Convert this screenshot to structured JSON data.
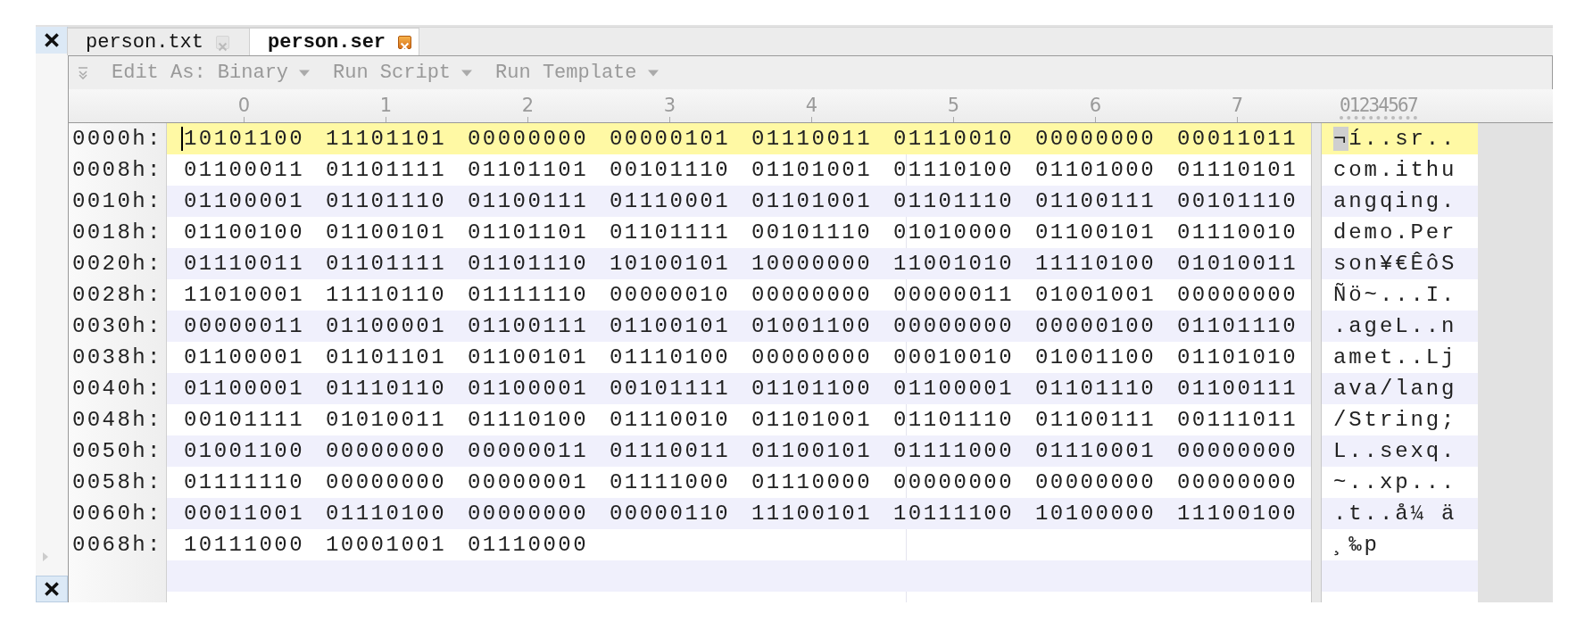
{
  "tabs": [
    {
      "label": "person.txt",
      "selected": false
    },
    {
      "label": "person.ser",
      "selected": true
    }
  ],
  "toolbar": {
    "items": [
      {
        "label": "Edit As: Binary"
      },
      {
        "label": "Run Script"
      },
      {
        "label": "Run Template"
      }
    ]
  },
  "ruler": {
    "columns": [
      "0",
      "1",
      "2",
      "3",
      "4",
      "5",
      "6",
      "7"
    ],
    "char_columns": "01234567"
  },
  "rows": [
    {
      "offset": "0000h:",
      "bytes": [
        "10101100",
        "11101101",
        "00000000",
        "00000101",
        "01110011",
        "01110010",
        "00000000",
        "00011011"
      ],
      "chars": "¬í..sr..",
      "selected": true
    },
    {
      "offset": "0008h:",
      "bytes": [
        "01100011",
        "01101111",
        "01101101",
        "00101110",
        "01101001",
        "01110100",
        "01101000",
        "01110101"
      ],
      "chars": "com.ithu",
      "selected": false
    },
    {
      "offset": "0010h:",
      "bytes": [
        "01100001",
        "01101110",
        "01100111",
        "01110001",
        "01101001",
        "01101110",
        "01100111",
        "00101110"
      ],
      "chars": "angqing.",
      "selected": false
    },
    {
      "offset": "0018h:",
      "bytes": [
        "01100100",
        "01100101",
        "01101101",
        "01101111",
        "00101110",
        "01010000",
        "01100101",
        "01110010"
      ],
      "chars": "demo.Per",
      "selected": false
    },
    {
      "offset": "0020h:",
      "bytes": [
        "01110011",
        "01101111",
        "01101110",
        "10100101",
        "10000000",
        "11001010",
        "11110100",
        "01010011"
      ],
      "chars": "son¥€ÊôS",
      "selected": false
    },
    {
      "offset": "0028h:",
      "bytes": [
        "11010001",
        "11110110",
        "01111110",
        "00000010",
        "00000000",
        "00000011",
        "01001001",
        "00000000"
      ],
      "chars": "Ñö~...I.",
      "selected": false
    },
    {
      "offset": "0030h:",
      "bytes": [
        "00000011",
        "01100001",
        "01100111",
        "01100101",
        "01001100",
        "00000000",
        "00000100",
        "01101110"
      ],
      "chars": ".ageL..n",
      "selected": false
    },
    {
      "offset": "0038h:",
      "bytes": [
        "01100001",
        "01101101",
        "01100101",
        "01110100",
        "00000000",
        "00010010",
        "01001100",
        "01101010"
      ],
      "chars": "amet..Lj",
      "selected": false
    },
    {
      "offset": "0040h:",
      "bytes": [
        "01100001",
        "01110110",
        "01100001",
        "00101111",
        "01101100",
        "01100001",
        "01101110",
        "01100111"
      ],
      "chars": "ava/lang",
      "selected": false
    },
    {
      "offset": "0048h:",
      "bytes": [
        "00101111",
        "01010011",
        "01110100",
        "01110010",
        "01101001",
        "01101110",
        "01100111",
        "00111011"
      ],
      "chars": "/String;",
      "selected": false
    },
    {
      "offset": "0050h:",
      "bytes": [
        "01001100",
        "00000000",
        "00000011",
        "01110011",
        "01100101",
        "01111000",
        "01110001",
        "00000000"
      ],
      "chars": "L..sexq.",
      "selected": false
    },
    {
      "offset": "0058h:",
      "bytes": [
        "01111110",
        "00000000",
        "00000001",
        "01111000",
        "01110000",
        "00000000",
        "00000000",
        "00000000"
      ],
      "chars": "~..xp...",
      "selected": false
    },
    {
      "offset": "0060h:",
      "bytes": [
        "00011001",
        "01110100",
        "00000000",
        "00000110",
        "11100101",
        "10111100",
        "10100000",
        "11100100"
      ],
      "chars": ".t..å¼ ä",
      "selected": false
    },
    {
      "offset": "0068h:",
      "bytes": [
        "10111000",
        "10001001",
        "01110000"
      ],
      "chars": "¸‰p",
      "selected": false
    }
  ]
}
